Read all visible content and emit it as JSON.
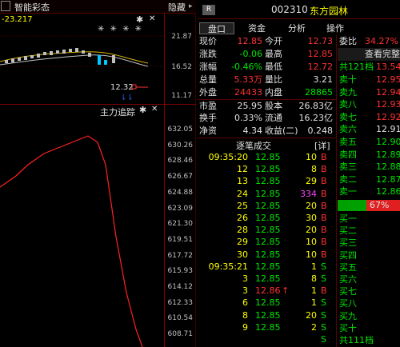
{
  "left": {
    "title_value": "-23.217",
    "title_label": "智能彩态",
    "title_right": "隐藏",
    "kline_axis": [
      "21.87",
      "16.52",
      "11.17"
    ],
    "kline_marker": "12.32",
    "kline_stars": "✳ ✳      ✳ ✳",
    "kline_arrows": "⇂⇂",
    "main_title": "主力追踪",
    "main_axis": [
      "632.05",
      "630.26",
      "628.46",
      "626.67",
      "624.88",
      "623.09",
      "621.30",
      "619.51",
      "617.72",
      "615.93",
      "614.12",
      "612.33",
      "610.54",
      "608.71"
    ]
  },
  "right": {
    "badge": "R",
    "code": "002310",
    "name": "东方园林",
    "tabs": [
      "盘口",
      "资金",
      "分析",
      "操作"
    ],
    "quote": [
      {
        "l1": "现价",
        "v1": "12.85",
        "l2": "今开",
        "v2": "12.73"
      },
      {
        "l1": "涨跌",
        "v1": "-0.06",
        "l2": "最高",
        "v2": "12.85"
      },
      {
        "l1": "涨幅",
        "v1": "-0.46%",
        "l2": "最低",
        "v2": "12.72"
      },
      {
        "l1": "总量",
        "v1": "5.33万",
        "l2": "量比",
        "v2": "3.21"
      },
      {
        "l1": "外盘",
        "v1": "24433",
        "l2": "内盘",
        "v2": "28865"
      },
      {
        "l1": "市盈",
        "v1": "25.95",
        "l2": "股本",
        "v2": "26.83亿"
      },
      {
        "l1": "换手",
        "v1": "0.33%",
        "l2": "流通",
        "v2": "16.23亿"
      },
      {
        "l1": "净资",
        "v1": "4.34",
        "l2": "收益(二)",
        "v2": "0.248"
      }
    ],
    "trades_title": "逐笔成交",
    "trades_detail": "[详]",
    "trades": [
      {
        "t": "09:35:20",
        "p": "12.85",
        "v": "10",
        "s": "B"
      },
      {
        "t": "12",
        "p": "12.85",
        "v": "8",
        "s": "B"
      },
      {
        "t": "13",
        "p": "12.85",
        "v": "29",
        "s": "B"
      },
      {
        "t": "24",
        "p": "12.85",
        "v": "334",
        "s": "B"
      },
      {
        "t": "25",
        "p": "12.85",
        "v": "20",
        "s": "B"
      },
      {
        "t": "26",
        "p": "12.85",
        "v": "30",
        "s": "B"
      },
      {
        "t": "28",
        "p": "12.85",
        "v": "20",
        "s": "B"
      },
      {
        "t": "29",
        "p": "12.85",
        "v": "10",
        "s": "B"
      },
      {
        "t": "30",
        "p": "12.85",
        "v": "10",
        "s": "B"
      },
      {
        "t": "09:35:21",
        "p": "12.85",
        "v": "1",
        "s": "S"
      },
      {
        "t": "3",
        "p": "12.85",
        "v": "8",
        "s": "S"
      },
      {
        "t": "3",
        "p": "12.86",
        "v": "1",
        "s": "B"
      },
      {
        "t": "6",
        "p": "12.85",
        "v": "1",
        "s": "S"
      },
      {
        "t": "8",
        "p": "12.85",
        "v": "20",
        "s": "S"
      },
      {
        "t": "9",
        "p": "12.85",
        "v": "2",
        "s": "S"
      },
      {
        "t": "",
        "p": "",
        "v": "",
        "s": "S"
      }
    ],
    "order_head": {
      "label": "委比",
      "value": "34.27%"
    },
    "order_link": "查看完整",
    "sell_head": {
      "label": "共121档",
      "value": "13.54"
    },
    "sells": [
      {
        "l": "卖十",
        "v": "12.95"
      },
      {
        "l": "卖九",
        "v": "12.94"
      },
      {
        "l": "卖八",
        "v": "12.93"
      },
      {
        "l": "卖七",
        "v": "12.92"
      },
      {
        "l": "卖六",
        "v": "12.91"
      },
      {
        "l": "卖五",
        "v": "12.90"
      },
      {
        "l": "卖四",
        "v": "12.89"
      },
      {
        "l": "卖三",
        "v": "12.88"
      },
      {
        "l": "卖二",
        "v": "12.87"
      },
      {
        "l": "卖一",
        "v": "12.86"
      }
    ],
    "ratio": "67%",
    "buys": [
      "买一",
      "买二",
      "买三",
      "买四",
      "买五",
      "买六",
      "买七",
      "买八",
      "买九",
      "买十"
    ],
    "buy_foot": "共111档"
  },
  "colors": {
    "up": "#ff3232",
    "down": "#00e600",
    "accent": "#ffff00",
    "bg": "#000000"
  }
}
